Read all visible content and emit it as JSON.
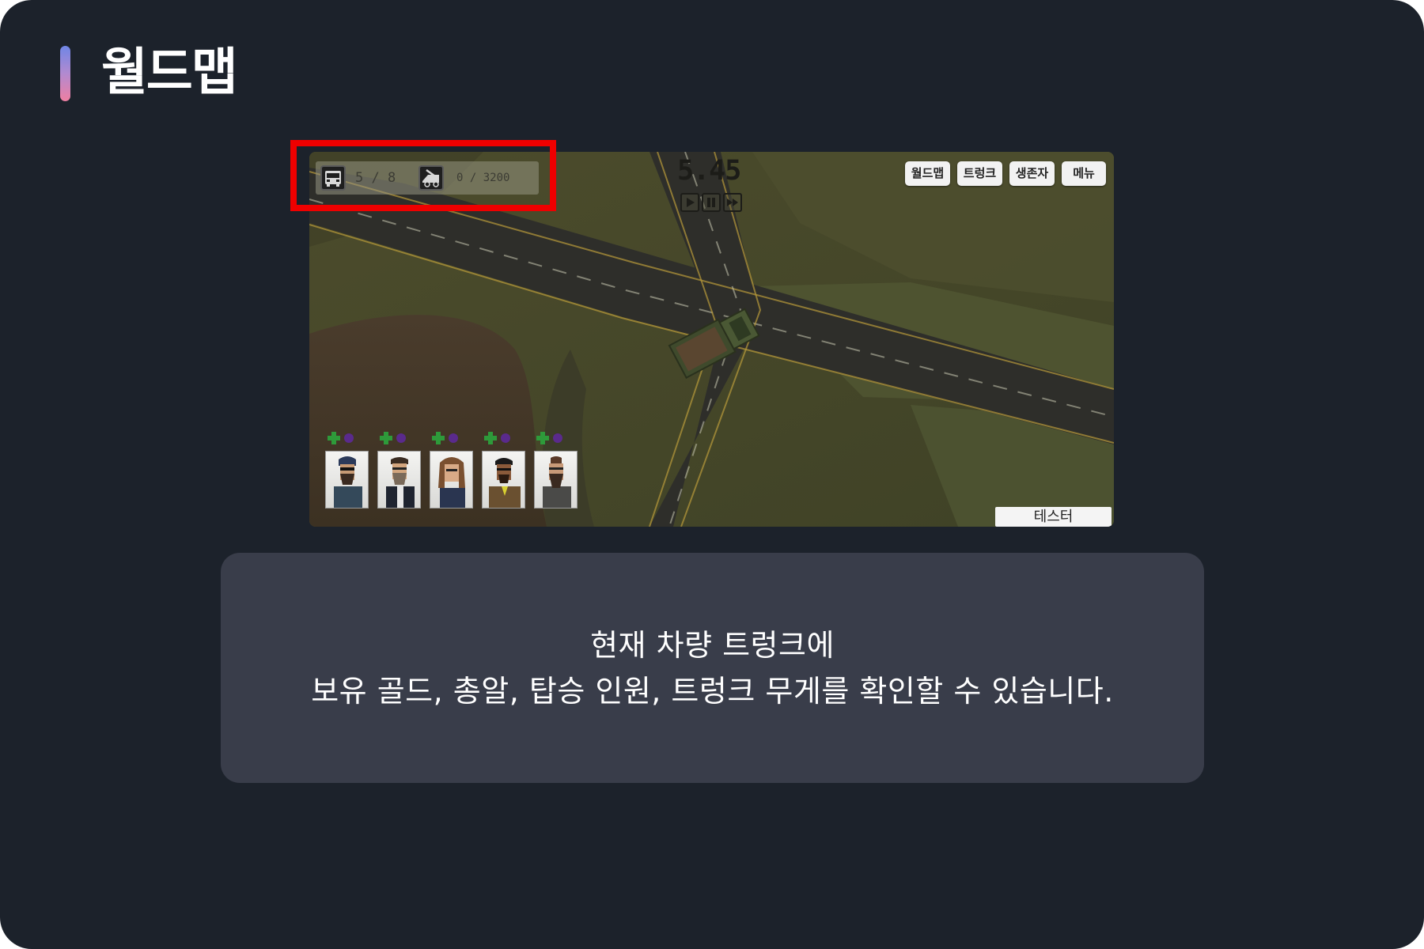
{
  "page": {
    "title": "월드맵"
  },
  "game": {
    "hud": {
      "passengers": "5 / 8",
      "trunk_weight": "0 / 3200",
      "passenger_icon": "bus-icon",
      "trunk_icon": "truck-trunk-icon"
    },
    "speed": {
      "value": "5.45",
      "controls": [
        {
          "name": "play-button",
          "icon": "play-icon"
        },
        {
          "name": "pause-button",
          "icon": "pause-icon"
        },
        {
          "name": "fast-forward-button",
          "icon": "fast-forward-icon"
        }
      ]
    },
    "top_buttons": [
      "월드맵",
      "트렁크",
      "생존자",
      "메뉴"
    ],
    "survivors": [
      {
        "status_icons": [
          "health-plus-icon",
          "purple-orb-icon"
        ]
      },
      {
        "status_icons": [
          "health-plus-icon",
          "purple-orb-icon"
        ]
      },
      {
        "status_icons": [
          "health-plus-icon",
          "purple-orb-icon"
        ]
      },
      {
        "status_icons": [
          "health-plus-icon",
          "purple-orb-icon"
        ]
      },
      {
        "status_icons": [
          "health-plus-icon",
          "purple-orb-icon"
        ]
      }
    ],
    "tester_button": "테스터"
  },
  "caption": {
    "line1": "현재 차량 트렁크에",
    "line2": "보유 골드, 총알, 탑승 인원, 트렁크 무게를 확인할 수 있습니다."
  },
  "colors": {
    "background": "#1c222b",
    "caption_panel": "#393d4a",
    "highlight": "#ef0000",
    "accent_gradient": [
      "#6f86e6",
      "#ee7fa2"
    ]
  }
}
